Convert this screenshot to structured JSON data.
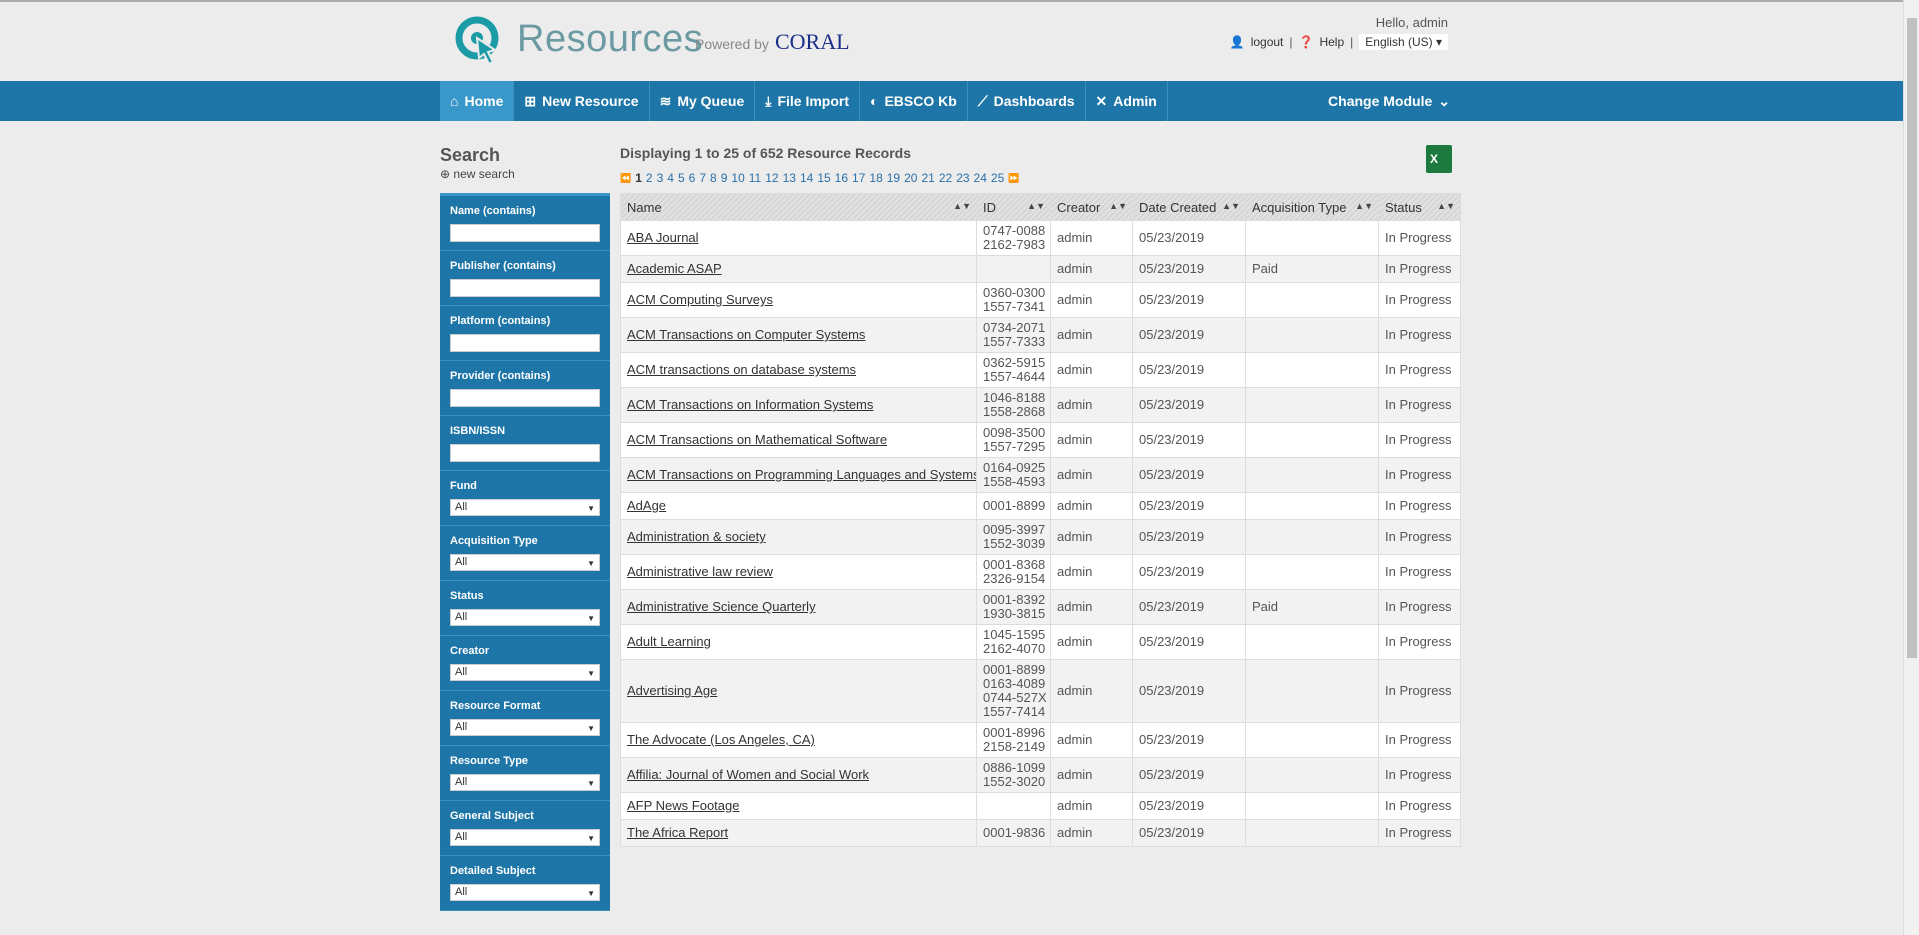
{
  "header": {
    "brand": "Resources",
    "powered_by": "Powered by",
    "coral": "CORAL",
    "hello": "Hello, admin",
    "logout": "logout",
    "help": "Help",
    "language": "English (US)"
  },
  "nav": {
    "items": [
      "Home",
      "New Resource",
      "My Queue",
      "File Import",
      "EBSCO Kb",
      "Dashboards",
      "Admin"
    ],
    "change_module": "Change Module"
  },
  "sidebar": {
    "title": "Search",
    "new_search": "new search",
    "filters": [
      {
        "label": "Name (contains)",
        "type": "text",
        "value": ""
      },
      {
        "label": "Publisher (contains)",
        "type": "text",
        "value": ""
      },
      {
        "label": "Platform (contains)",
        "type": "text",
        "value": ""
      },
      {
        "label": "Provider (contains)",
        "type": "text",
        "value": ""
      },
      {
        "label": "ISBN/ISSN",
        "type": "text",
        "value": ""
      },
      {
        "label": "Fund",
        "type": "select",
        "value": "All"
      },
      {
        "label": "Acquisition Type",
        "type": "select",
        "value": "All"
      },
      {
        "label": "Status",
        "type": "select",
        "value": "All"
      },
      {
        "label": "Creator",
        "type": "select",
        "value": "All"
      },
      {
        "label": "Resource Format",
        "type": "select",
        "value": "All"
      },
      {
        "label": "Resource Type",
        "type": "select",
        "value": "All"
      },
      {
        "label": "General Subject",
        "type": "select",
        "value": "All"
      },
      {
        "label": "Detailed Subject",
        "type": "select",
        "value": "All"
      }
    ]
  },
  "main": {
    "displaying": "Displaying 1 to 25 of 652 Resource Records",
    "current_page": "1",
    "pages": [
      "2",
      "3",
      "4",
      "5",
      "6",
      "7",
      "8",
      "9",
      "10",
      "11",
      "12",
      "13",
      "14",
      "15",
      "16",
      "17",
      "18",
      "19",
      "20",
      "21",
      "22",
      "23",
      "24",
      "25"
    ],
    "excel": "X",
    "columns": [
      "Name",
      "ID",
      "Creator",
      "Date Created",
      "Acquisition Type",
      "Status"
    ],
    "rows": [
      {
        "name": "ABA Journal",
        "ids": [
          "0747-0088",
          "2162-7983"
        ],
        "creator": "admin",
        "date": "05/23/2019",
        "acq": "",
        "status": "In Progress"
      },
      {
        "name": "Academic ASAP",
        "ids": [],
        "creator": "admin",
        "date": "05/23/2019",
        "acq": "Paid",
        "status": "In Progress"
      },
      {
        "name": "ACM Computing Surveys",
        "ids": [
          "0360-0300",
          "1557-7341"
        ],
        "creator": "admin",
        "date": "05/23/2019",
        "acq": "",
        "status": "In Progress"
      },
      {
        "name": "ACM Transactions on Computer Systems",
        "ids": [
          "0734-2071",
          "1557-7333"
        ],
        "creator": "admin",
        "date": "05/23/2019",
        "acq": "",
        "status": "In Progress"
      },
      {
        "name": "ACM transactions on database systems",
        "ids": [
          "0362-5915",
          "1557-4644"
        ],
        "creator": "admin",
        "date": "05/23/2019",
        "acq": "",
        "status": "In Progress"
      },
      {
        "name": "ACM Transactions on Information Systems",
        "ids": [
          "1046-8188",
          "1558-2868"
        ],
        "creator": "admin",
        "date": "05/23/2019",
        "acq": "",
        "status": "In Progress"
      },
      {
        "name": "ACM Transactions on Mathematical Software",
        "ids": [
          "0098-3500",
          "1557-7295"
        ],
        "creator": "admin",
        "date": "05/23/2019",
        "acq": "",
        "status": "In Progress"
      },
      {
        "name": "ACM Transactions on Programming Languages and Systems",
        "ids": [
          "0164-0925",
          "1558-4593"
        ],
        "creator": "admin",
        "date": "05/23/2019",
        "acq": "",
        "status": "In Progress"
      },
      {
        "name": "AdAge",
        "ids": [
          "0001-8899"
        ],
        "creator": "admin",
        "date": "05/23/2019",
        "acq": "",
        "status": "In Progress"
      },
      {
        "name": "Administration & society",
        "ids": [
          "0095-3997",
          "1552-3039"
        ],
        "creator": "admin",
        "date": "05/23/2019",
        "acq": "",
        "status": "In Progress"
      },
      {
        "name": "Administrative law review",
        "ids": [
          "0001-8368",
          "2326-9154"
        ],
        "creator": "admin",
        "date": "05/23/2019",
        "acq": "",
        "status": "In Progress"
      },
      {
        "name": "Administrative Science Quarterly",
        "ids": [
          "0001-8392",
          "1930-3815"
        ],
        "creator": "admin",
        "date": "05/23/2019",
        "acq": "Paid",
        "status": "In Progress"
      },
      {
        "name": "Adult Learning",
        "ids": [
          "1045-1595",
          "2162-4070"
        ],
        "creator": "admin",
        "date": "05/23/2019",
        "acq": "",
        "status": "In Progress"
      },
      {
        "name": "Advertising Age",
        "ids": [
          "0001-8899",
          "0163-4089",
          "0744-527X",
          "1557-7414"
        ],
        "creator": "admin",
        "date": "05/23/2019",
        "acq": "",
        "status": "In Progress"
      },
      {
        "name": "The Advocate (Los Angeles, CA)",
        "ids": [
          "0001-8996",
          "2158-2149"
        ],
        "creator": "admin",
        "date": "05/23/2019",
        "acq": "",
        "status": "In Progress"
      },
      {
        "name": "Affilia: Journal of Women and Social Work",
        "ids": [
          "0886-1099",
          "1552-3020"
        ],
        "creator": "admin",
        "date": "05/23/2019",
        "acq": "",
        "status": "In Progress"
      },
      {
        "name": "AFP News Footage",
        "ids": [],
        "creator": "admin",
        "date": "05/23/2019",
        "acq": "",
        "status": "In Progress"
      },
      {
        "name": "The Africa Report",
        "ids": [
          "0001-9836"
        ],
        "creator": "admin",
        "date": "05/23/2019",
        "acq": "",
        "status": "In Progress"
      }
    ]
  }
}
